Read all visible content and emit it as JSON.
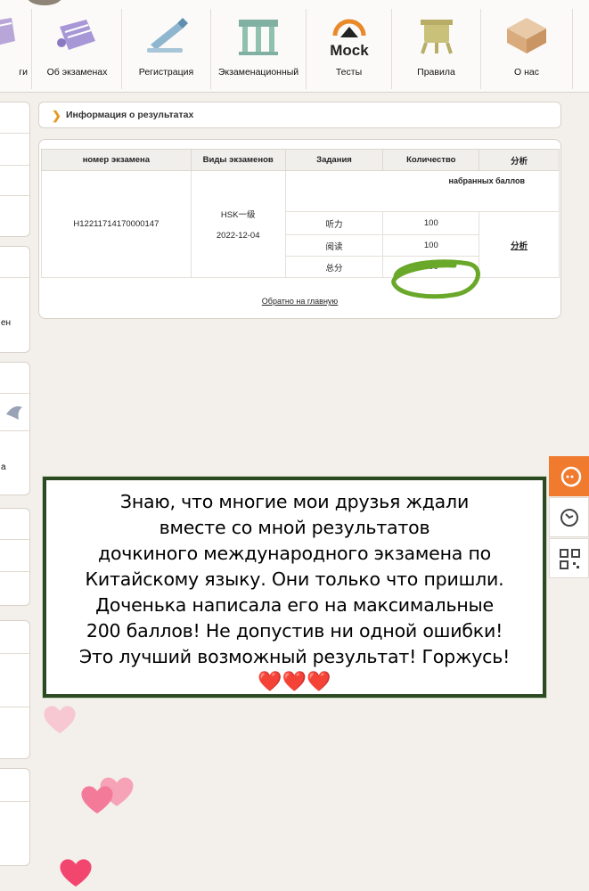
{
  "nav": {
    "items": [
      {
        "label": "ги",
        "icon": "scroll-icon"
      },
      {
        "label": "Об экзаменах",
        "icon": "scroll-icon"
      },
      {
        "label": "Регистрация",
        "icon": "pen-icon"
      },
      {
        "label": "Экзаменационный",
        "icon": "gate-icon"
      },
      {
        "label": "Тесты",
        "icon": "mock-logo-icon",
        "logo_text": "Mock"
      },
      {
        "label": "Правила",
        "icon": "vessel-icon"
      },
      {
        "label": "О нас",
        "icon": "box-icon"
      }
    ]
  },
  "sidebar": {
    "fragment_1": "ен",
    "fragment_2": "а"
  },
  "results": {
    "title": "Информация о результатах",
    "headers": [
      "номер экзамена",
      "Виды экзаменов",
      "Задания",
      "Количество",
      "分析"
    ],
    "subheader": "набранных баллов",
    "exam_number": "H12211714170000147",
    "exam_type": "HSK一级",
    "exam_date": "2022-12-04",
    "rows": [
      {
        "task": "听力",
        "score": "100"
      },
      {
        "task": "阅读",
        "score": "100"
      },
      {
        "task": "总分",
        "score": "200"
      }
    ],
    "analysis_link": "分析",
    "back_link": "Обратно на главную"
  },
  "caption": {
    "lines": [
      "Знаю, что многие мои друзья ждали",
      "вместе со мной результатов",
      "дочкиного международного экзамена по",
      "Китайскому языку. Они только что пришли.",
      "Доченька написала его на максимальные",
      "200 баллов! Не допустив ни одной ошибки!",
      "Это лучший возможный результат! Горжусь!"
    ],
    "hearts": "❤️❤️❤️"
  },
  "colors": {
    "accent_orange": "#f07a2e",
    "caption_border": "#2c4a22",
    "highlight_green": "#6aa82a",
    "heart_pink": "#f47a9a"
  }
}
